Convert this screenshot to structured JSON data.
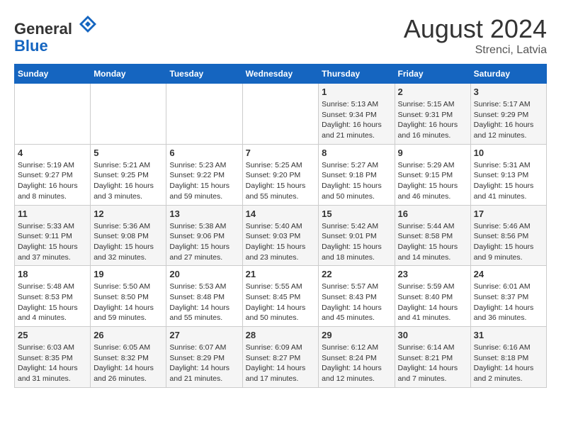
{
  "header": {
    "logo_line1": "General",
    "logo_line2": "Blue",
    "month_title": "August 2024",
    "subtitle": "Strenci, Latvia"
  },
  "weekdays": [
    "Sunday",
    "Monday",
    "Tuesday",
    "Wednesday",
    "Thursday",
    "Friday",
    "Saturday"
  ],
  "weeks": [
    [
      {
        "day": "",
        "info": ""
      },
      {
        "day": "",
        "info": ""
      },
      {
        "day": "",
        "info": ""
      },
      {
        "day": "",
        "info": ""
      },
      {
        "day": "1",
        "info": "Sunrise: 5:13 AM\nSunset: 9:34 PM\nDaylight: 16 hours\nand 21 minutes."
      },
      {
        "day": "2",
        "info": "Sunrise: 5:15 AM\nSunset: 9:31 PM\nDaylight: 16 hours\nand 16 minutes."
      },
      {
        "day": "3",
        "info": "Sunrise: 5:17 AM\nSunset: 9:29 PM\nDaylight: 16 hours\nand 12 minutes."
      }
    ],
    [
      {
        "day": "4",
        "info": "Sunrise: 5:19 AM\nSunset: 9:27 PM\nDaylight: 16 hours\nand 8 minutes."
      },
      {
        "day": "5",
        "info": "Sunrise: 5:21 AM\nSunset: 9:25 PM\nDaylight: 16 hours\nand 3 minutes."
      },
      {
        "day": "6",
        "info": "Sunrise: 5:23 AM\nSunset: 9:22 PM\nDaylight: 15 hours\nand 59 minutes."
      },
      {
        "day": "7",
        "info": "Sunrise: 5:25 AM\nSunset: 9:20 PM\nDaylight: 15 hours\nand 55 minutes."
      },
      {
        "day": "8",
        "info": "Sunrise: 5:27 AM\nSunset: 9:18 PM\nDaylight: 15 hours\nand 50 minutes."
      },
      {
        "day": "9",
        "info": "Sunrise: 5:29 AM\nSunset: 9:15 PM\nDaylight: 15 hours\nand 46 minutes."
      },
      {
        "day": "10",
        "info": "Sunrise: 5:31 AM\nSunset: 9:13 PM\nDaylight: 15 hours\nand 41 minutes."
      }
    ],
    [
      {
        "day": "11",
        "info": "Sunrise: 5:33 AM\nSunset: 9:11 PM\nDaylight: 15 hours\nand 37 minutes."
      },
      {
        "day": "12",
        "info": "Sunrise: 5:36 AM\nSunset: 9:08 PM\nDaylight: 15 hours\nand 32 minutes."
      },
      {
        "day": "13",
        "info": "Sunrise: 5:38 AM\nSunset: 9:06 PM\nDaylight: 15 hours\nand 27 minutes."
      },
      {
        "day": "14",
        "info": "Sunrise: 5:40 AM\nSunset: 9:03 PM\nDaylight: 15 hours\nand 23 minutes."
      },
      {
        "day": "15",
        "info": "Sunrise: 5:42 AM\nSunset: 9:01 PM\nDaylight: 15 hours\nand 18 minutes."
      },
      {
        "day": "16",
        "info": "Sunrise: 5:44 AM\nSunset: 8:58 PM\nDaylight: 15 hours\nand 14 minutes."
      },
      {
        "day": "17",
        "info": "Sunrise: 5:46 AM\nSunset: 8:56 PM\nDaylight: 15 hours\nand 9 minutes."
      }
    ],
    [
      {
        "day": "18",
        "info": "Sunrise: 5:48 AM\nSunset: 8:53 PM\nDaylight: 15 hours\nand 4 minutes."
      },
      {
        "day": "19",
        "info": "Sunrise: 5:50 AM\nSunset: 8:50 PM\nDaylight: 14 hours\nand 59 minutes."
      },
      {
        "day": "20",
        "info": "Sunrise: 5:53 AM\nSunset: 8:48 PM\nDaylight: 14 hours\nand 55 minutes."
      },
      {
        "day": "21",
        "info": "Sunrise: 5:55 AM\nSunset: 8:45 PM\nDaylight: 14 hours\nand 50 minutes."
      },
      {
        "day": "22",
        "info": "Sunrise: 5:57 AM\nSunset: 8:43 PM\nDaylight: 14 hours\nand 45 minutes."
      },
      {
        "day": "23",
        "info": "Sunrise: 5:59 AM\nSunset: 8:40 PM\nDaylight: 14 hours\nand 41 minutes."
      },
      {
        "day": "24",
        "info": "Sunrise: 6:01 AM\nSunset: 8:37 PM\nDaylight: 14 hours\nand 36 minutes."
      }
    ],
    [
      {
        "day": "25",
        "info": "Sunrise: 6:03 AM\nSunset: 8:35 PM\nDaylight: 14 hours\nand 31 minutes."
      },
      {
        "day": "26",
        "info": "Sunrise: 6:05 AM\nSunset: 8:32 PM\nDaylight: 14 hours\nand 26 minutes."
      },
      {
        "day": "27",
        "info": "Sunrise: 6:07 AM\nSunset: 8:29 PM\nDaylight: 14 hours\nand 21 minutes."
      },
      {
        "day": "28",
        "info": "Sunrise: 6:09 AM\nSunset: 8:27 PM\nDaylight: 14 hours\nand 17 minutes."
      },
      {
        "day": "29",
        "info": "Sunrise: 6:12 AM\nSunset: 8:24 PM\nDaylight: 14 hours\nand 12 minutes."
      },
      {
        "day": "30",
        "info": "Sunrise: 6:14 AM\nSunset: 8:21 PM\nDaylight: 14 hours\nand 7 minutes."
      },
      {
        "day": "31",
        "info": "Sunrise: 6:16 AM\nSunset: 8:18 PM\nDaylight: 14 hours\nand 2 minutes."
      }
    ]
  ]
}
